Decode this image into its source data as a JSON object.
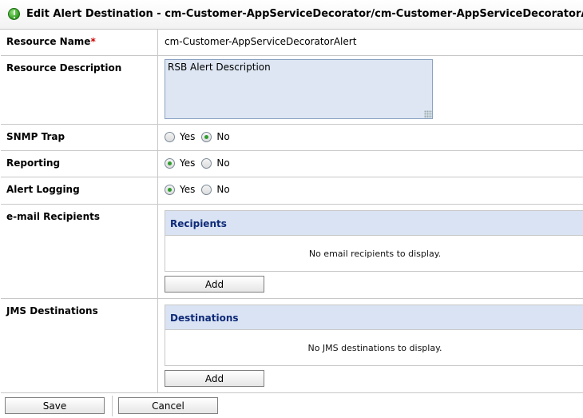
{
  "header": {
    "icon": "alert-green-icon",
    "title": "Edit Alert Destination - cm-Customer-AppServiceDecorator/cm-Customer-AppServiceDecoratorAlert"
  },
  "form": {
    "resource_name": {
      "label": "Resource Name",
      "required_mark": "*",
      "value": "cm-Customer-AppServiceDecoratorAlert"
    },
    "resource_description": {
      "label": "Resource Description",
      "value": "RSB Alert Description"
    },
    "snmp_trap": {
      "label": "SNMP Trap",
      "yes_label": "Yes",
      "no_label": "No",
      "selected": "No"
    },
    "reporting": {
      "label": "Reporting",
      "yes_label": "Yes",
      "no_label": "No",
      "selected": "Yes"
    },
    "alert_logging": {
      "label": "Alert Logging",
      "yes_label": "Yes",
      "no_label": "No",
      "selected": "Yes"
    },
    "email_recipients": {
      "label": "e-mail Recipients",
      "panel_title": "Recipients",
      "empty_text": "No email recipients to display.",
      "add_label": "Add"
    },
    "jms_destinations": {
      "label": "JMS Destinations",
      "panel_title": "Destinations",
      "empty_text": "No JMS destinations to display.",
      "add_label": "Add"
    }
  },
  "footer": {
    "save_label": "Save",
    "cancel_label": "Cancel"
  },
  "colors": {
    "panel_header_bg": "#d9e3f3",
    "panel_header_text": "#0e2a78",
    "required": "#cc0000",
    "radio_checked": "#2e9c2e"
  }
}
